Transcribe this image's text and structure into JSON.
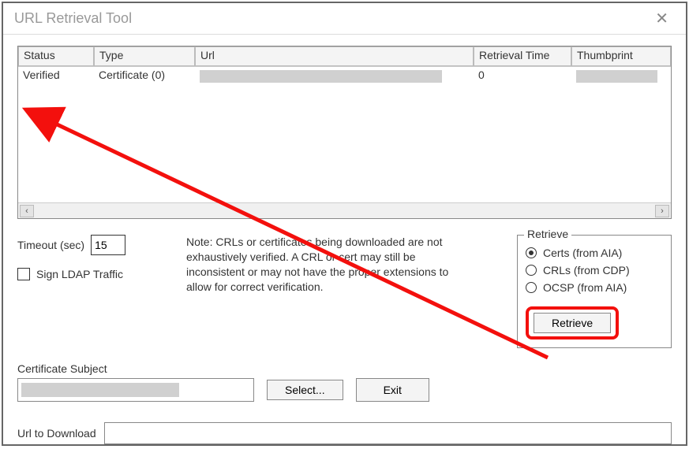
{
  "window": {
    "title": "URL Retrieval Tool"
  },
  "grid": {
    "headers": {
      "status": "Status",
      "type": "Type",
      "url": "Url",
      "retrieval_time": "Retrieval Time",
      "thumbprint": "Thumbprint"
    },
    "rows": [
      {
        "status": "Verified",
        "type": "Certificate (0)",
        "url": "",
        "retrieval_time": "0",
        "thumbprint": ""
      }
    ]
  },
  "timeout": {
    "label": "Timeout (sec)",
    "value": "15"
  },
  "sign_ldap": {
    "label": "Sign LDAP Traffic",
    "checked": false
  },
  "note_text": "Note: CRLs or certificates being downloaded are not exhaustively verified.  A CRL or cert may still be inconsistent or may not have the proper extensions to allow for correct verification.",
  "retrieve": {
    "legend": "Retrieve",
    "options": {
      "certs": "Certs (from AIA)",
      "crls": "CRLs (from CDP)",
      "ocsp": "OCSP (from AIA)"
    },
    "selected": "certs",
    "button": "Retrieve"
  },
  "subject": {
    "label": "Certificate Subject",
    "select_button": "Select...",
    "exit_button": "Exit"
  },
  "url_download": {
    "label": "Url to Download",
    "value": ""
  },
  "annotation": {
    "arrow_color": "#f3100d"
  }
}
